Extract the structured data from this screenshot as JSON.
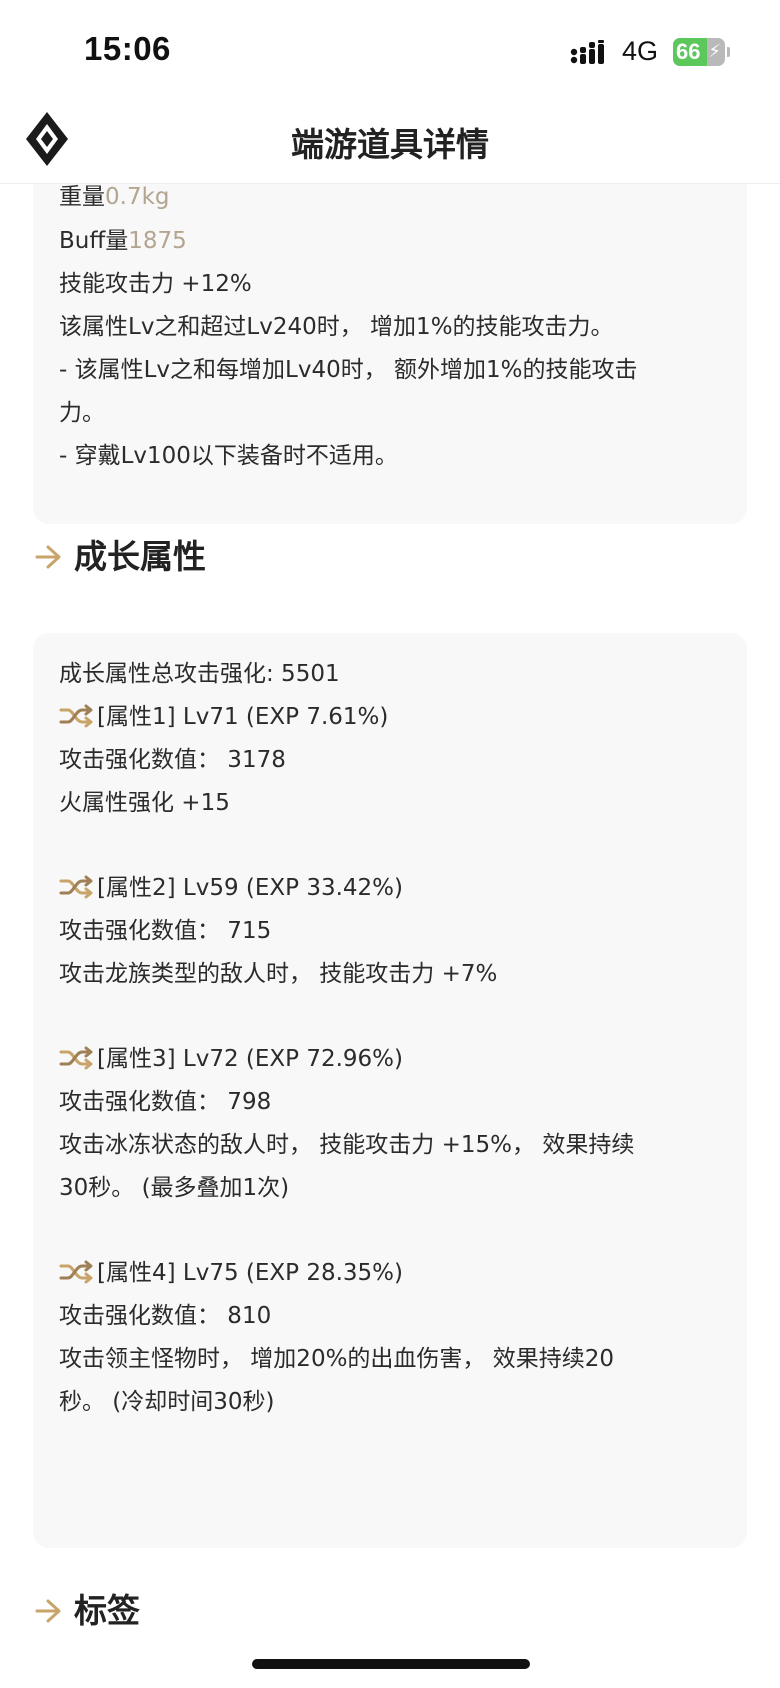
{
  "status_bar": {
    "time": "15:06",
    "network": "4G",
    "battery_level": "66",
    "battery_fraction": 0.66,
    "icons": [
      "signal-bars-icon",
      "battery-icon",
      "charging-bolt-icon"
    ]
  },
  "header": {
    "title": "端游道具详情",
    "logo_icon": "diamond-logo-icon"
  },
  "top_card": {
    "weight_label": "重量",
    "weight_value": "0.7kg",
    "buff_label": "Buff量",
    "buff_value": "1875",
    "lines": [
      "技能攻击力 +12%",
      "该属性Lv之和超过Lv240时， 增加1%的技能攻击力。",
      "- 该属性Lv之和每增加Lv40时， 额外增加1%的技能攻击",
      "力。",
      "- 穿戴Lv100以下装备时不适用。"
    ]
  },
  "growth_section": {
    "title": "成长属性",
    "heading_icon": "arrow-right-icon",
    "total": "成长属性总攻击强化: 5501",
    "attributes": [
      {
        "header": "[属性1] Lv71 (EXP 7.61%)",
        "value": "攻击强化数值： 3178",
        "effect_lines": [
          "火属性强化 +15"
        ]
      },
      {
        "header": "[属性2] Lv59 (EXP 33.42%)",
        "value": "攻击强化数值： 715",
        "effect_lines": [
          "攻击龙族类型的敌人时， 技能攻击力 +7%"
        ]
      },
      {
        "header": "[属性3] Lv72 (EXP 72.96%)",
        "value": "攻击强化数值： 798",
        "effect_lines": [
          "攻击冰冻状态的敌人时， 技能攻击力 +15%， 效果持续",
          "30秒。 (最多叠加1次)"
        ]
      },
      {
        "header": "[属性4] Lv75 (EXP 28.35%)",
        "value": "攻击强化数值： 810",
        "effect_lines": [
          "攻击领主怪物时， 增加20%的出血伤害， 效果持续20",
          "秒。 (冷却时间30秒)"
        ]
      }
    ],
    "attribute_icon": "shuffle-icon"
  },
  "tags_section": {
    "title": "标签",
    "heading_icon": "arrow-right-icon"
  },
  "colors": {
    "accent_gold": "#c9a46a",
    "muted_text": "#b3a58f",
    "card_bg": "#f8f8f8",
    "battery_green": "#5cc85c"
  }
}
